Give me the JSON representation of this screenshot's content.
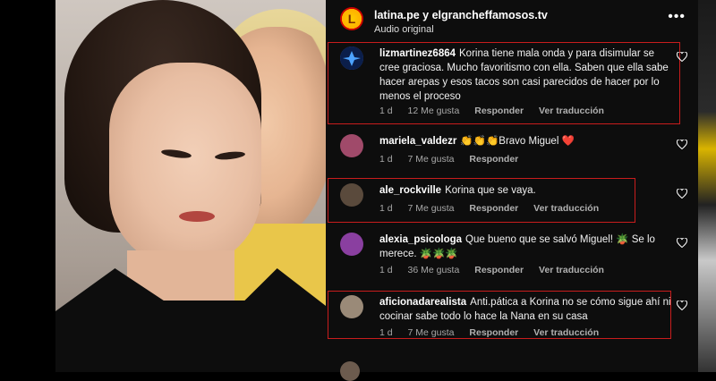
{
  "header": {
    "logo_letter": "L",
    "title": "latina.pe y elgrancheffamosos.tv",
    "subtitle": "Audio original",
    "more_icon": "more-horizontal-icon"
  },
  "colors": {
    "highlight": "#c81d1d",
    "panel_bg": "#0d0d0d",
    "meta_text": "#a8a8a8"
  },
  "comments": [
    {
      "user": "lizmartinez6864",
      "text": "Korina tiene mala onda y para disimular se cree graciosa. Mucho favoritismo con ella. Saben que ella sabe hacer arepas y esos tacos son casi parecidos de hacer por lo menos el proceso",
      "time": "1 d",
      "likes": "12 Me gusta",
      "reply": "Responder",
      "translate": "Ver traducción",
      "highlighted": true,
      "avatar_color": "#3b6bd6"
    },
    {
      "user": "mariela_valdezr",
      "text": "👏👏👏Bravo Miguel ❤️",
      "time": "1 d",
      "likes": "7 Me gusta",
      "reply": "Responder",
      "translate": "",
      "highlighted": false,
      "avatar_color": "#a04a6a"
    },
    {
      "user": "ale_rockville",
      "text": "Korina que se vaya.",
      "time": "1 d",
      "likes": "7 Me gusta",
      "reply": "Responder",
      "translate": "Ver traducción",
      "highlighted": true,
      "avatar_color": "#5a4a3c"
    },
    {
      "user": "alexia_psicologa",
      "text": "Que bueno que se salvó Miguel! 🪴 Se lo merece. 🪴🪴🪴",
      "time": "1 d",
      "likes": "36 Me gusta",
      "reply": "Responder",
      "translate": "Ver traducción",
      "highlighted": false,
      "avatar_color": "#8a3fa0"
    },
    {
      "user": "aficionadarealista",
      "text": "Anti.pática a Korina no se cómo sigue ahí ni cocinar sabe todo lo hace la Nana en su casa",
      "time": "1 d",
      "likes": "7 Me gusta",
      "reply": "Responder",
      "translate": "Ver traducción",
      "highlighted": true,
      "avatar_color": "#9a8a78"
    }
  ]
}
